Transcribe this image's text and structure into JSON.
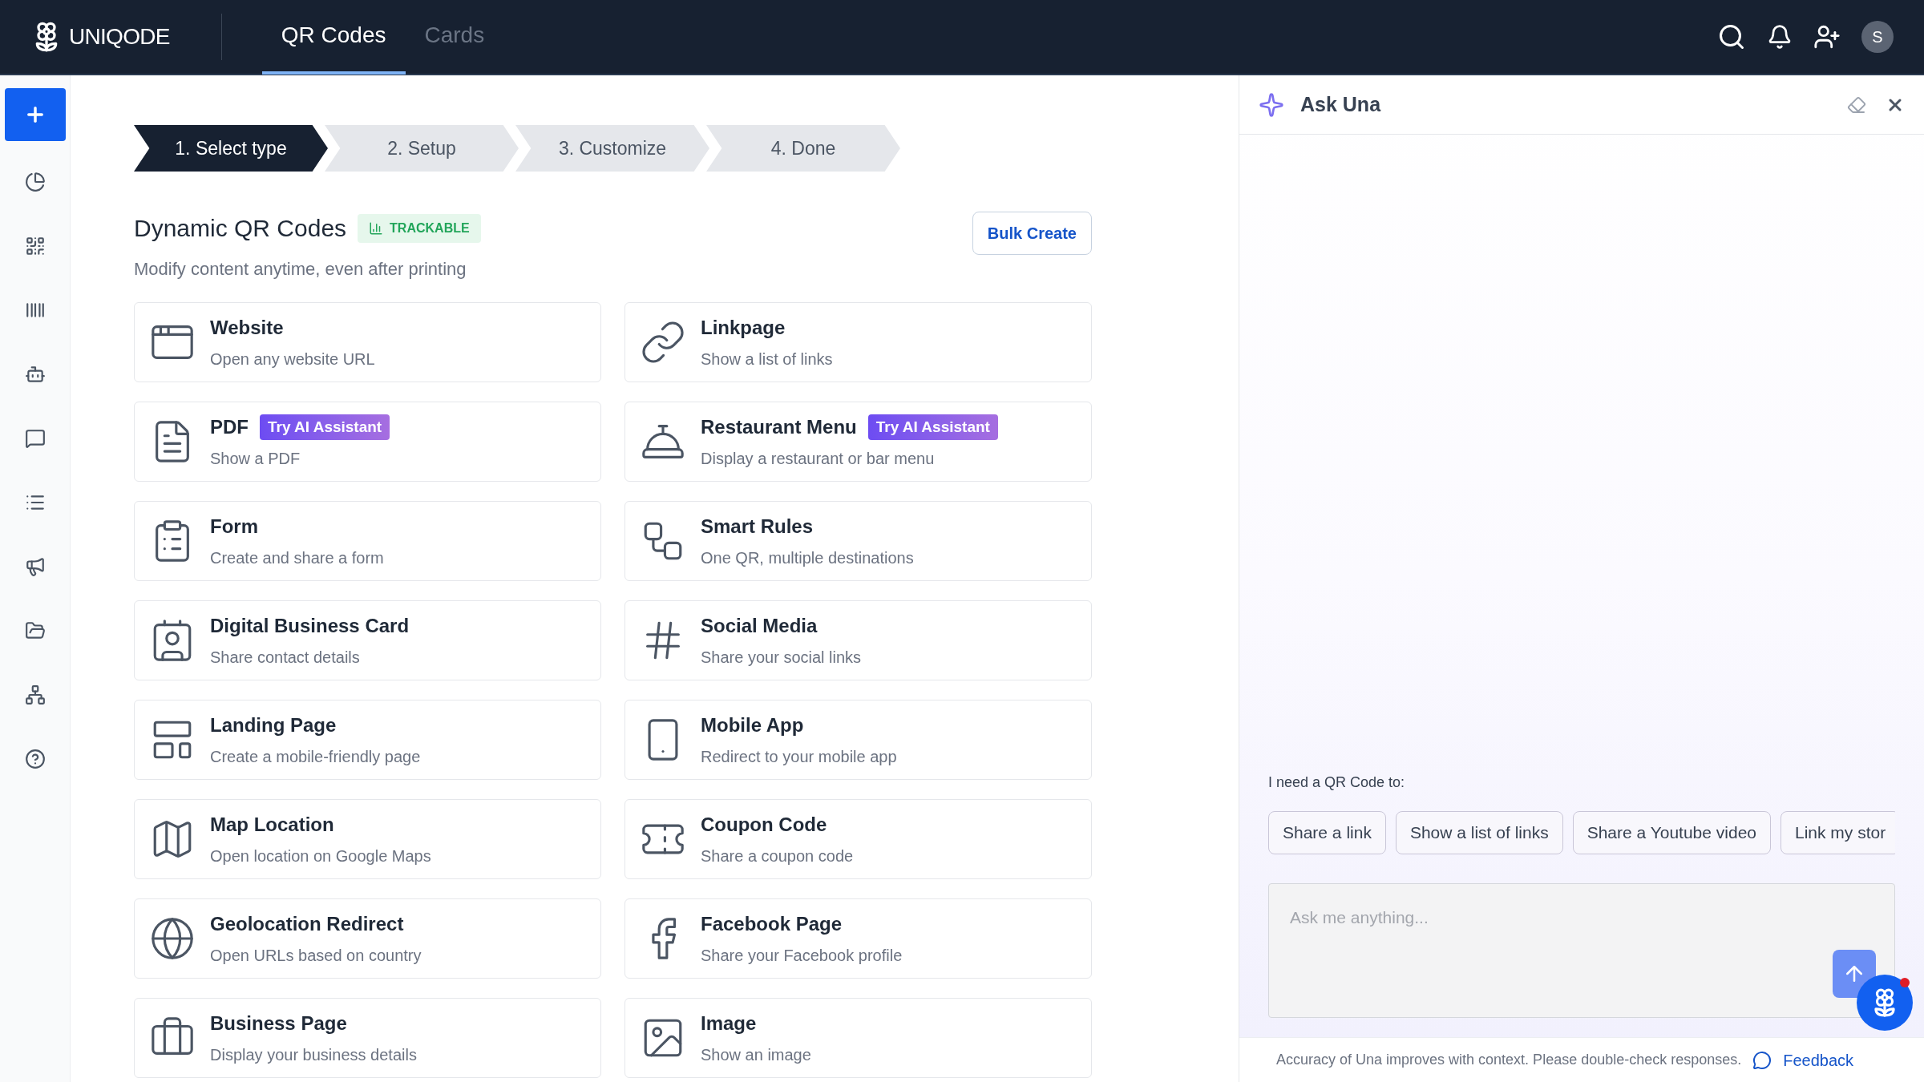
{
  "brand": {
    "name": "UNIQODE"
  },
  "nav_tabs": [
    {
      "label": "QR Codes",
      "selected": true
    },
    {
      "label": "Cards",
      "selected": false
    }
  ],
  "user": {
    "initial": "S"
  },
  "steps": [
    {
      "label": "1. Select type",
      "selected": true
    },
    {
      "label": "2. Setup",
      "selected": false
    },
    {
      "label": "3. Customize",
      "selected": false
    },
    {
      "label": "4. Done",
      "selected": false
    }
  ],
  "section": {
    "title": "Dynamic QR Codes",
    "tag": "TRACKABLE",
    "subtitle": "Modify content anytime, even after printing",
    "action": "Bulk Create"
  },
  "qr_types": [
    {
      "title": "Website",
      "description": "Open any website URL"
    },
    {
      "title": "Linkpage",
      "description": "Show a list of links"
    },
    {
      "title": "PDF",
      "description": "Show a PDF",
      "badge": "Try AI Assistant"
    },
    {
      "title": "Restaurant Menu",
      "description": "Display a restaurant or bar menu",
      "badge": "Try AI Assistant"
    },
    {
      "title": "Form",
      "description": "Create and share a form"
    },
    {
      "title": "Smart Rules",
      "description": "One QR, multiple destinations"
    },
    {
      "title": "Digital Business Card",
      "description": "Share contact details"
    },
    {
      "title": "Social Media",
      "description": "Share your social links"
    },
    {
      "title": "Landing Page",
      "description": "Create a mobile-friendly page"
    },
    {
      "title": "Mobile App",
      "description": "Redirect to your mobile app"
    },
    {
      "title": "Map Location",
      "description": "Open location on Google Maps"
    },
    {
      "title": "Coupon Code",
      "description": "Share a coupon code"
    },
    {
      "title": "Geolocation Redirect",
      "description": "Open URLs based on country"
    },
    {
      "title": "Facebook Page",
      "description": "Share your Facebook profile"
    },
    {
      "title": "Business Page",
      "description": "Display your business details"
    },
    {
      "title": "Image",
      "description": "Show an image"
    }
  ],
  "assistant": {
    "title": "Ask Una",
    "prompt_label": "I need a QR Code to:",
    "suggestions": [
      "Share a link",
      "Show a list of links",
      "Share a Youtube video",
      "Link my stor"
    ],
    "input": {
      "placeholder": "Ask me anything..."
    },
    "disclaimer": "Accuracy of Una improves with context. Please double-check responses.",
    "feedback": "Feedback"
  }
}
